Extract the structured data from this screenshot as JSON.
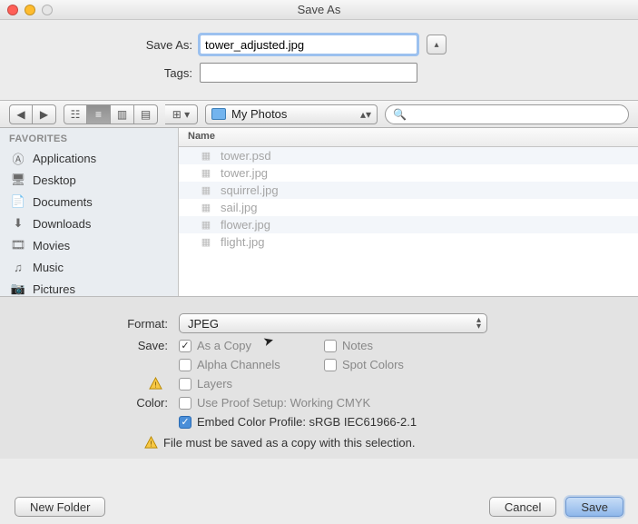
{
  "window": {
    "title": "Save As"
  },
  "form": {
    "saveas_label": "Save As:",
    "tags_label": "Tags:",
    "filename": "tower_adjusted.jpg",
    "tags": ""
  },
  "toolbar": {
    "path": "My Photos",
    "search_placeholder": ""
  },
  "sidebar": {
    "header": "FAVORITES",
    "items": [
      {
        "label": "Applications",
        "icon": "apps-icon"
      },
      {
        "label": "Desktop",
        "icon": "desktop-icon"
      },
      {
        "label": "Documents",
        "icon": "documents-icon"
      },
      {
        "label": "Downloads",
        "icon": "downloads-icon"
      },
      {
        "label": "Movies",
        "icon": "movies-icon"
      },
      {
        "label": "Music",
        "icon": "music-icon"
      },
      {
        "label": "Pictures",
        "icon": "pictures-icon"
      }
    ]
  },
  "listing": {
    "header": "Name",
    "files": [
      {
        "name": "tower.psd"
      },
      {
        "name": "tower.jpg"
      },
      {
        "name": "squirrel.jpg"
      },
      {
        "name": "sail.jpg"
      },
      {
        "name": "flower.jpg"
      },
      {
        "name": "flight.jpg"
      }
    ]
  },
  "options": {
    "format_label": "Format:",
    "format_value": "JPEG",
    "save_label": "Save:",
    "as_a_copy": "As a Copy",
    "notes": "Notes",
    "alpha": "Alpha Channels",
    "spot": "Spot Colors",
    "layers": "Layers",
    "color_label": "Color:",
    "proof_setup": "Use Proof Setup:  Working CMYK",
    "embed_profile": "Embed Color Profile:  sRGB IEC61966-2.1",
    "warning": "File must be saved as a copy with this selection."
  },
  "buttons": {
    "new_folder": "New Folder",
    "cancel": "Cancel",
    "save": "Save"
  }
}
